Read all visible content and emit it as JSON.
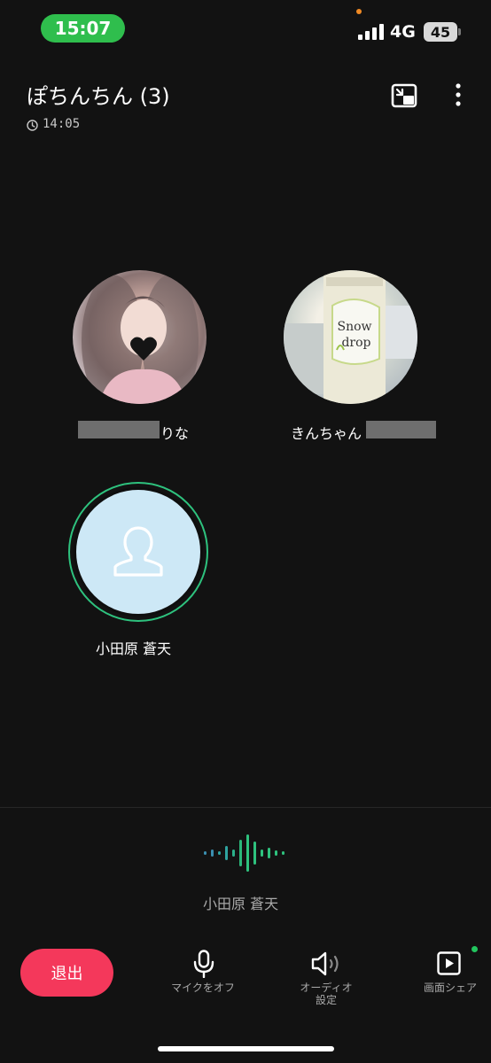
{
  "status_bar": {
    "time": "15:07",
    "network": "4G",
    "battery": "45",
    "pill_color": "#2fbe4d"
  },
  "header": {
    "title": "ぽちんちん (3)",
    "duration": "14:05",
    "pip_icon": "picture-in-picture-icon",
    "more_icon": "more-vertical-icon"
  },
  "participants": [
    {
      "name_visible_suffix": "りな",
      "avatar": "photo-portrait"
    },
    {
      "name_visible_prefix": "きんちゃん",
      "avatar": "photo-snowdrop-bottle"
    },
    {
      "name": "小田原 蒼天",
      "avatar": "default-person-icon",
      "speaking": true
    }
  ],
  "active_speaker": {
    "name": "小田原 蒼天"
  },
  "controls": {
    "leave_label": "退出",
    "mic_label": "マイクをオフ",
    "audio_label": "オーディオ\n設定",
    "audio_label_line1": "オーディオ",
    "audio_label_line2": "設定",
    "share_label": "画面シェア"
  },
  "colors": {
    "background": "#121212",
    "leave": "#f4385b",
    "speaking_ring": "#2ec27e",
    "default_avatar_bg": "#cde8f6"
  }
}
